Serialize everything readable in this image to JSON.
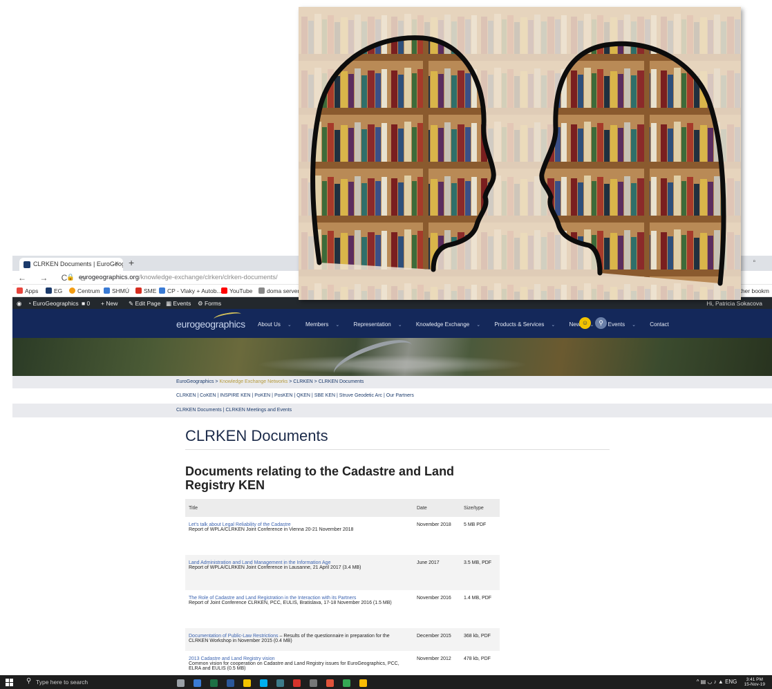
{
  "browser": {
    "tab_title": "CLRKEN Documents | EuroGeog",
    "tab_close": "×",
    "new_tab": "+",
    "url_host": "eurogeographics.org",
    "url_path": "/knowledge-exchange/clrken/clrken-documents/",
    "window_controls": "– ▫",
    "nav_icons": "← → C ⌂",
    "bookmarks": [
      {
        "label": "Apps",
        "color": "#e8453c"
      },
      {
        "label": "EG",
        "color": "#1b3a6b"
      },
      {
        "label": "Centrum",
        "color": "#f39c12"
      },
      {
        "label": "SHMÚ",
        "color": "#3a7bd5"
      },
      {
        "label": "SME",
        "color": "#d62d20"
      },
      {
        "label": "CP - Vlaky + Autob...",
        "color": "#3a7bd5"
      },
      {
        "label": "YouTube",
        "color": "#ff0000"
      },
      {
        "label": "doma server",
        "color": "#888888"
      }
    ],
    "other_bookmarks": "Other bookm"
  },
  "admin_bar": {
    "site": "EuroGeographics",
    "comments": "0",
    "new": "+ New",
    "edit_page": "Edit Page",
    "events": "Events",
    "forms": "Forms",
    "greeting": "Hi, Patricia Sokacova"
  },
  "site": {
    "logo_left": "eurogeo",
    "logo_right": "graphics",
    "nav": [
      "About Us",
      "Members",
      "Representation",
      "Knowledge Exchange",
      "Products & Services",
      "News",
      "Events",
      "Contact"
    ],
    "brand_color": "#14285a",
    "accent_color": "#f2c300"
  },
  "breadcrumb": {
    "home": "EuroGeographics",
    "sep": " > ",
    "level1": "Knowledge Exchange Networks",
    "level2": "CLRKEN",
    "current": "CLRKEN Documents"
  },
  "ken_links": [
    "CLRKEN",
    "CoKEN",
    "INSPIRE KEN",
    "PoKEN",
    "PosKEN",
    "QKEN",
    "SBE KEN",
    "Struve Geodetic Arc",
    "Our Partners"
  ],
  "sub_links": [
    "CLRKEN Documents",
    "CLRKEN Meetings and Events"
  ],
  "page_title": "CLRKEN Documents",
  "section_title": "Documents relating to the Cadastre and Land Registry KEN",
  "table": {
    "headers": [
      "Title",
      "Date",
      "Size/type"
    ],
    "rows": [
      {
        "link": "Let's talk about Legal Reliability of the Cadastre",
        "desc": "Report of WPLA/CLRKEN Joint Conference in Vienna 20-21 November 2018",
        "date": "November 2018",
        "size": "5 MB PDF"
      },
      {
        "link": "Land Administration and Land Management in the Information Age",
        "desc": "Report of WPLA/CLRKEN Joint Conference in Lausanne, 21 April 2017 (3.4 MB)",
        "date": "June 2017",
        "size": "3.5 MB, PDF"
      },
      {
        "link": "The Role of Cadastre and Land Registration in the Interaction with its Partners",
        "desc": "Report of Joint Conference CLRKEN, PCC, EULIS, Bratislava, 17-18 November 2016 (1.5 MB)",
        "date": "November 2016",
        "size": "1.4 MB, PDF"
      },
      {
        "link": "Documentation of Public-Law Restrictions",
        "desc": " – Results of the questionnaire in preparation for the CLRKEN Workshop in November 2015 (0.4 MB)",
        "date": "December 2015",
        "size": "368 kb, PDF"
      },
      {
        "link": "2013 Cadastre and Land Registry vision",
        "desc": "Common vision for cooperation on Cadastre and Land Registry issues for EuroGeographics, PCC, ELRA and EULIS (0.5 MB)",
        "date": "November 2012",
        "size": "478 kb, PDF"
      }
    ]
  },
  "taskbar": {
    "search_placeholder": "Type here to search",
    "lang": "ENG",
    "time": "3:41 PM",
    "date": "15-Nov-19",
    "apps": [
      {
        "name": "task-view",
        "color": "#9aa0a6"
      },
      {
        "name": "network",
        "color": "#3a7bd5"
      },
      {
        "name": "excel",
        "color": "#1d7044"
      },
      {
        "name": "word",
        "color": "#2b579a"
      },
      {
        "name": "explorer",
        "color": "#f2c300"
      },
      {
        "name": "skype",
        "color": "#00aff0"
      },
      {
        "name": "app",
        "color": "#3d7b8a"
      },
      {
        "name": "acrobat",
        "color": "#d6332b"
      },
      {
        "name": "calculator",
        "color": "#777777"
      },
      {
        "name": "paint",
        "color": "#e0533a"
      },
      {
        "name": "chrome",
        "color": "#34a853"
      },
      {
        "name": "chrome-2",
        "color": "#fbbc05"
      }
    ]
  }
}
